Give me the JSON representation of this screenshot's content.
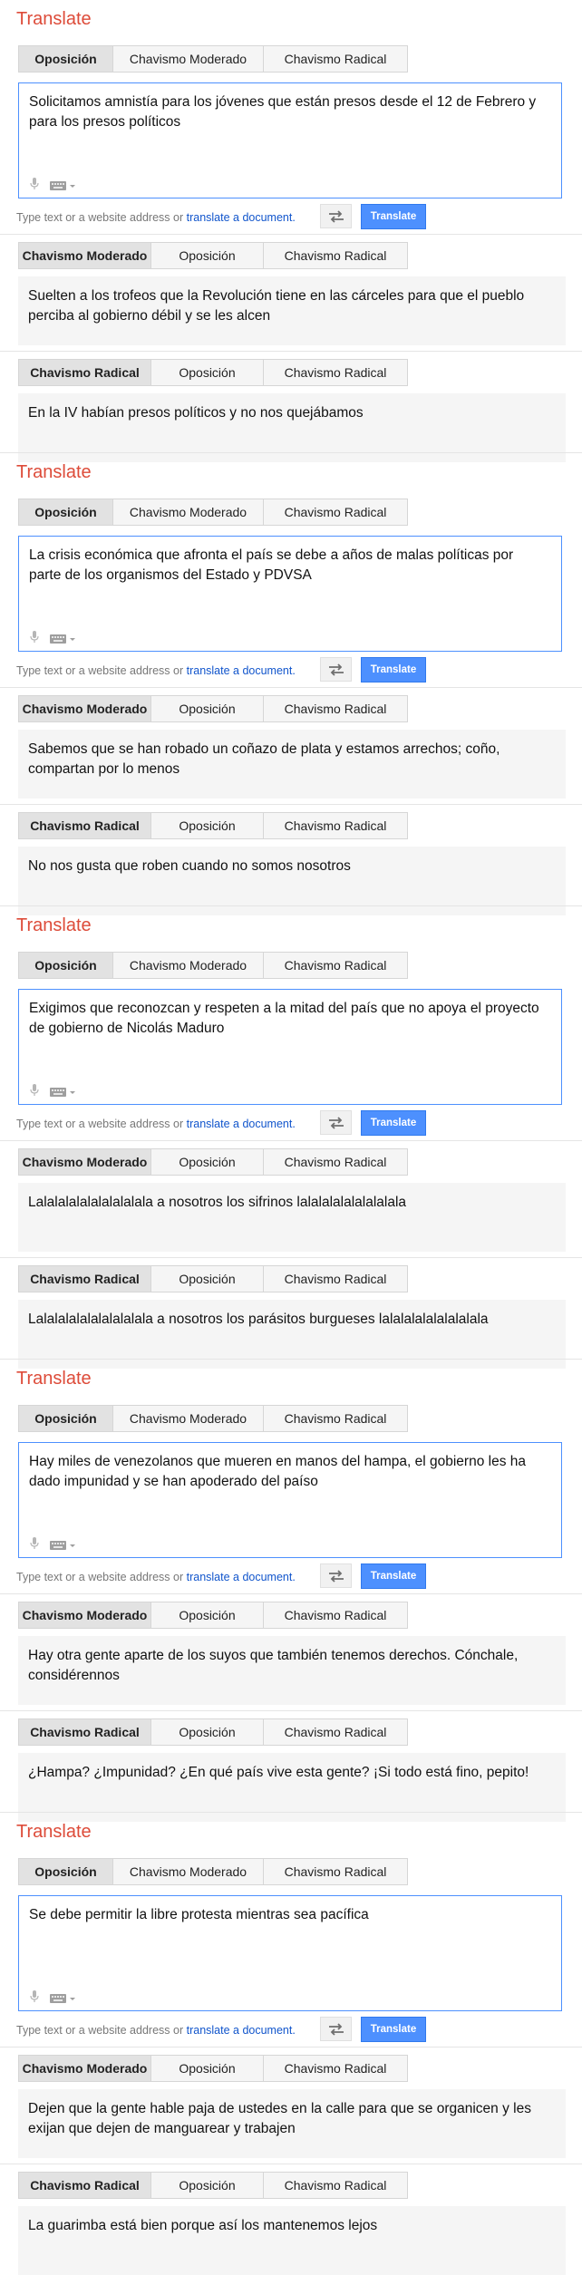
{
  "title": "Translate",
  "tabs": {
    "oposicion": "Oposición",
    "moderado": "Chavismo Moderado",
    "radical": "Chavismo Radical"
  },
  "hint": {
    "prefix": "Type text or a website address or",
    "link": "translate a document."
  },
  "translate_button": "Translate",
  "colors": {
    "accent": "#dd4b39",
    "button": "#4d90fe",
    "input_border": "#4d90fe"
  },
  "blocks": [
    {
      "input": "Solicitamos amnistía para los jóvenes que están presos desde el 12 de Febrero y para los presos políticos",
      "moderado": "Suelten a los trofeos que la Revolución tiene en las cárceles para que el pueblo perciba al gobierno débil y se les alcen",
      "radical": "En la IV habían presos políticos y no nos quejábamos"
    },
    {
      "input": "La crisis económica que afronta el país se debe a años de malas políticas por parte de los organismos del Estado y PDVSA",
      "moderado": "Sabemos que se han robado un coñazo de plata y estamos arrechos; coño, compartan por lo menos",
      "radical": "No nos gusta que roben cuando no somos nosotros"
    },
    {
      "input": "Exigimos que reconozcan y respeten a la mitad del país que no apoya el proyecto de gobierno de Nicolás Maduro",
      "moderado": "Lalalalalalalalalalala a nosotros los sifrinos lalalalalalalalalala",
      "radical": "Lalalalalalalalalalala a nosotros los parásitos burgueses lalalalalalalalalala"
    },
    {
      "input": "Hay miles de venezolanos que mueren en manos del hampa, el gobierno les ha dado impunidad y se han apoderado del paíso",
      "moderado": "Hay otra gente aparte de los suyos que también tenemos derechos. Cónchale, considérennos",
      "radical": "¿Hampa? ¿Impunidad? ¿En qué país vive esta gente? ¡Si todo está fino, pepito!"
    },
    {
      "input": "Se debe permitir la libre protesta mientras sea pacífica",
      "moderado": "Dejen que la gente hable paja de ustedes en la calle para que se organicen y les exijan que dejen de manguarear y trabajen",
      "radical": "La guarimba está bien porque así los mantenemos lejos"
    }
  ]
}
